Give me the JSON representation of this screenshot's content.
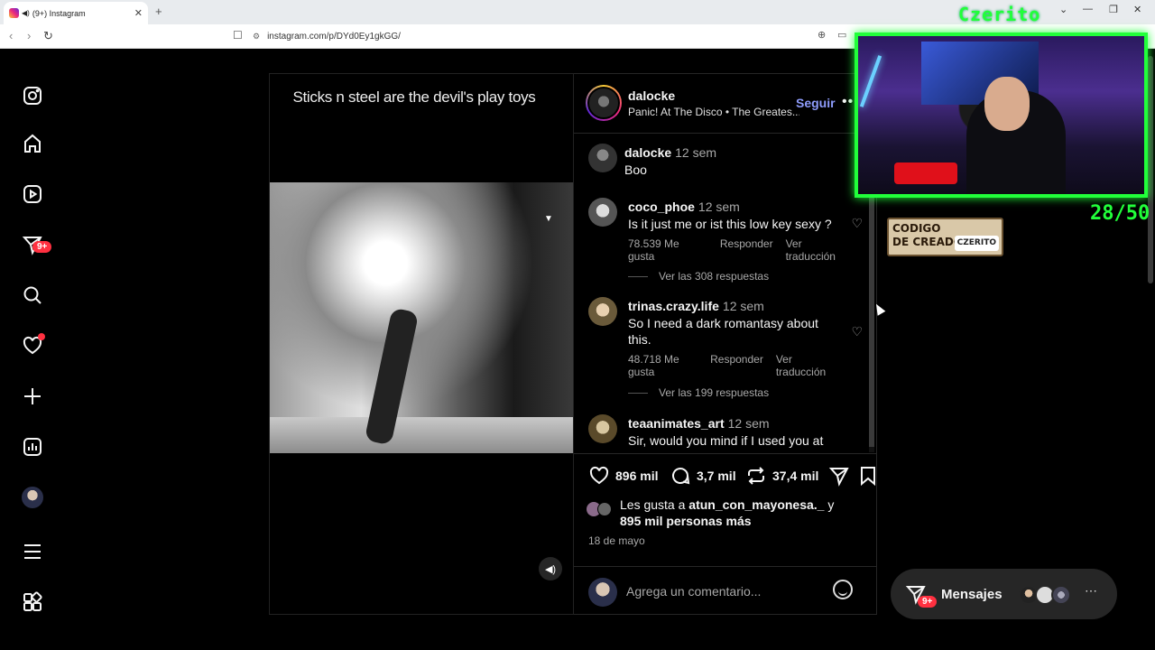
{
  "browser": {
    "tab_title": "(9+) Instagram",
    "url": "instagram.com/p/DYd0Ey1gkGG/"
  },
  "sidebar": {
    "items": [
      {
        "icon": "instagram-logo-icon"
      },
      {
        "icon": "home-icon"
      },
      {
        "icon": "reels-icon"
      },
      {
        "icon": "direct-messages-icon",
        "badge": "9+"
      },
      {
        "icon": "search-icon"
      },
      {
        "icon": "notifications-heart-icon"
      },
      {
        "icon": "create-plus-icon"
      },
      {
        "icon": "dashboard-icon"
      },
      {
        "icon": "profile-avatar"
      },
      {
        "icon": "menu-icon"
      },
      {
        "icon": "apps-grid-icon"
      }
    ]
  },
  "post": {
    "caption_overlay": "Sticks n steel are the devil's play toys",
    "author": "dalocke",
    "audio": "Panic! At The Disco • The Greates...",
    "follow_label": "Seguir",
    "more_label": "•••",
    "comments": [
      {
        "user": "dalocke",
        "time": "12 sem",
        "text": "Boo"
      },
      {
        "user": "coco_phoe",
        "time": "12 sem",
        "text": "Is it just me or ist this low key sexy ?",
        "likes": "78.539 Me gusta",
        "reply": "Responder",
        "translate": "Ver traducción",
        "replies": "Ver las 308 respuestas"
      },
      {
        "user": "trinas.crazy.life",
        "time": "12 sem",
        "text": "So I need a dark romantasy about this.",
        "likes": "48.718 Me gusta",
        "reply": "Responder",
        "translate": "Ver traducción",
        "replies": "Ver las 199 respuestas"
      },
      {
        "user": "teaanimates_art",
        "time": "12 sem",
        "text": "Sir, would you mind if I used you at"
      }
    ],
    "actions": {
      "likes": "896 mil",
      "comments": "3,7 mil",
      "reposts": "37,4 mil"
    },
    "liked_by_prefix": "Les gusta a ",
    "liked_by_user": "atun_con_mayonesa._",
    "liked_by_suffix": " y",
    "liked_by_others": "895 mil personas más",
    "date": "18 de mayo",
    "comment_placeholder": "Agrega un comentario..."
  },
  "overlay": {
    "stream_title": "Czerito",
    "counter": "28/50",
    "creator_code_line1": "CODIGO",
    "creator_code_line2": "DE CREADOR",
    "creator_tag": "CZERITO",
    "frame_color": "#21ff3a"
  },
  "messages": {
    "label": "Mensajes",
    "badge": "9+"
  }
}
